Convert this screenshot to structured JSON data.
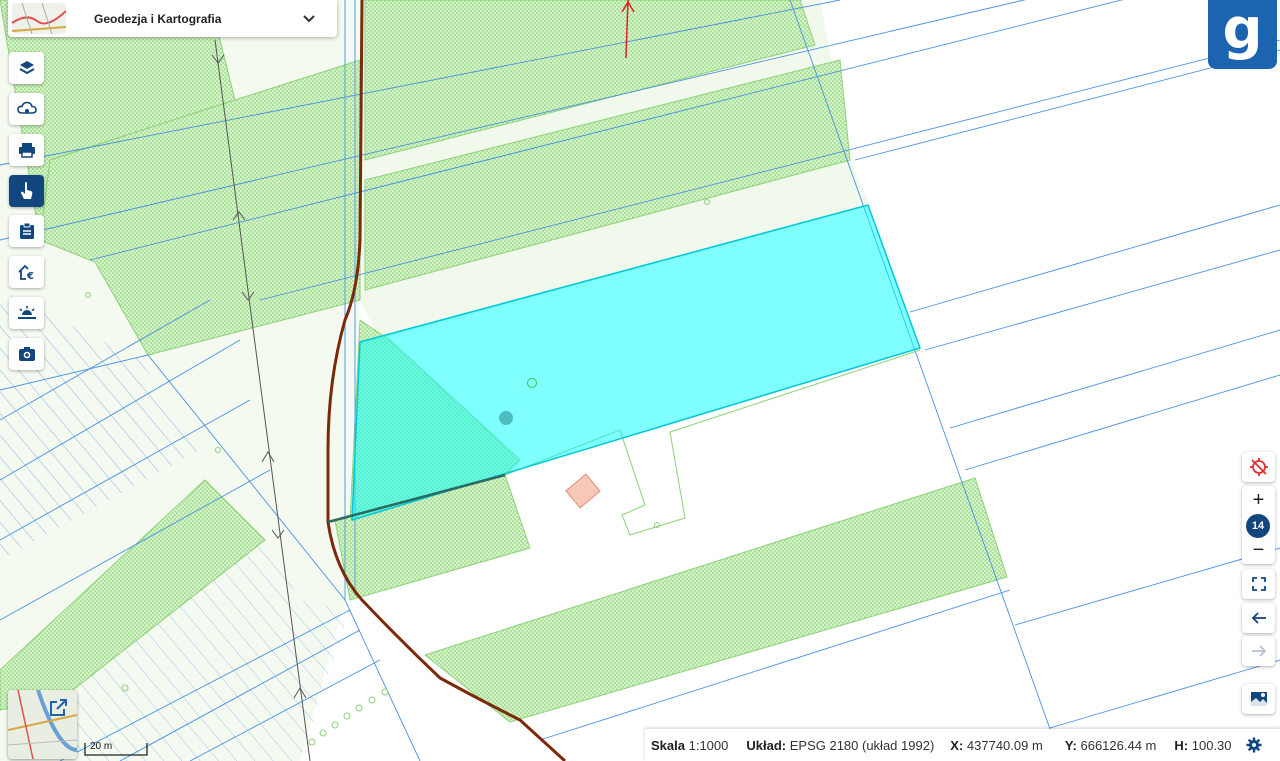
{
  "theme": {
    "title": "Geodezja i Kartografia",
    "chevron_icon": "chevron-down-icon"
  },
  "toolbar": [
    {
      "name": "layers-tool-button",
      "icon": "layers-icon",
      "active": false
    },
    {
      "name": "cloud-tool-button",
      "icon": "cloud-icon",
      "active": false
    },
    {
      "name": "print-tool-button",
      "icon": "printer-icon",
      "active": false
    },
    {
      "name": "identify-tool-button",
      "icon": "pointer-hand-icon",
      "active": true
    },
    {
      "name": "clipboard-tool-button",
      "icon": "clipboard-icon",
      "active": false
    },
    {
      "name": "real-estate-price-tool-button",
      "icon": "house-euro-icon",
      "active": false
    },
    {
      "name": "horizon-tool-button",
      "icon": "sunset-icon",
      "active": false
    },
    {
      "name": "screenshot-tool-button",
      "icon": "camera-icon",
      "active": false
    }
  ],
  "logo": {
    "letter": "g"
  },
  "right_tools": {
    "gps_icon": "location-off-icon",
    "zoom_in": "+",
    "zoom_level": "14",
    "zoom_out": "−",
    "fullscreen_icon": "fullscreen-icon",
    "back_icon": "arrow-left-icon",
    "forward_icon": "arrow-right-icon",
    "basemap_icon": "basemap-icon"
  },
  "status": {
    "scale_label": "Skala",
    "scale_value": "1:1000",
    "crs_label": "Układ:",
    "crs_value": "EPSG 2180 (układ 1992)",
    "x_label": "X:",
    "x_value": "437740.09 m",
    "y_label": "Y:",
    "y_value": "666126.44 m",
    "h_label": "H:",
    "h_value": "100.30",
    "settings_icon": "gear-icon"
  },
  "scale_bar": {
    "label": "20 m"
  },
  "overview": {
    "expand_icon": "external-link-icon"
  },
  "colors": {
    "active_tool": "#12467e",
    "logo_bg": "#1c64b0",
    "highlight": "#00ffff",
    "parcel_line": "#3b8be0",
    "forest_fill": "#c8eeb8",
    "road": "#7a2a0a"
  }
}
